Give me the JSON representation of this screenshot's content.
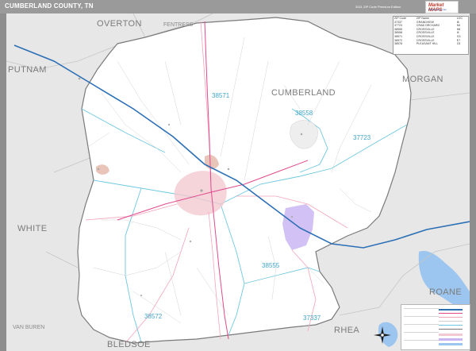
{
  "header": {
    "title": "CUMBERLAND COUNTY, TN",
    "edition": "2021 ZIP Code Premium Edition",
    "logo_text": "Market MAPS",
    "logo_sub": "marketmaps.com"
  },
  "colors": {
    "outside": "#e7e7e7",
    "county_fill": "#ffffff",
    "highway": "#2c6fb5",
    "us_route": "#e04a8c",
    "state_route": "#f4a4b8",
    "zip_boundary": "#6fc7e0",
    "urban": "#f3c9d1",
    "federal": "#c9b6f2",
    "water": "#9cc6ef"
  },
  "counties": {
    "overton": "OVERTON",
    "fentress": "FENTRESS",
    "putnam": "PUTNAM",
    "cumberland": "CUMBERLAND",
    "morgan": "MORGAN",
    "white": "WHITE",
    "roane": "ROANE",
    "van_buren": "VAN BUREN",
    "rhea": "RHEA",
    "bledsoe": "BLEDSOE"
  },
  "zips": {
    "z38571": "38571",
    "z38558": "38558",
    "z37723": "37723",
    "z38555": "38555",
    "z38572": "38572",
    "z37337": "37337"
  },
  "zip_table": {
    "headers": [
      "ZIP Code",
      "ZIP Name",
      "LOC"
    ],
    "rows": [
      [
        "37337",
        "GRANDVIEW",
        "I8"
      ],
      [
        "37723",
        "CRAB ORCHARD",
        "K6"
      ],
      [
        "38555",
        "CROSSVILLE",
        "H8"
      ],
      [
        "38558",
        "CROSSVILLE",
        "I4"
      ],
      [
        "38571",
        "CROSSVILLE",
        "G3"
      ],
      [
        "38572",
        "CROSSVILLE",
        "E7"
      ],
      [
        "38578",
        "PLEASANT HILL",
        "C5"
      ]
    ]
  }
}
